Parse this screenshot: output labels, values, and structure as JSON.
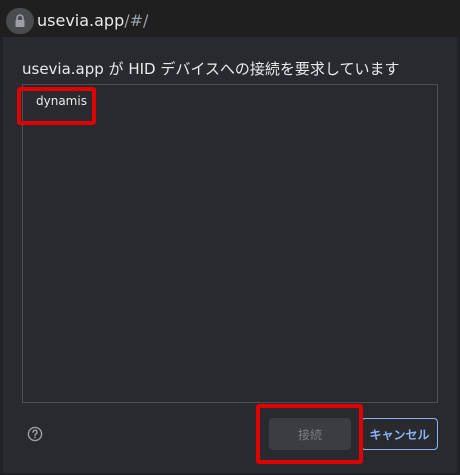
{
  "browser": {
    "url_host": "usevia.app",
    "url_path": "/#/"
  },
  "dialog": {
    "title": "usevia.app が HID デバイスへの接続を要求しています",
    "devices": [
      {
        "label": "dynamis"
      }
    ],
    "buttons": {
      "connect_label": "接続",
      "cancel_label": "キャンセル"
    }
  },
  "colors": {
    "accent": "#8ab4f8",
    "highlight": "#e00000",
    "dialog_bg": "#292a2d"
  },
  "icons": {
    "lock": "lock-icon",
    "help": "help-circle-icon"
  }
}
